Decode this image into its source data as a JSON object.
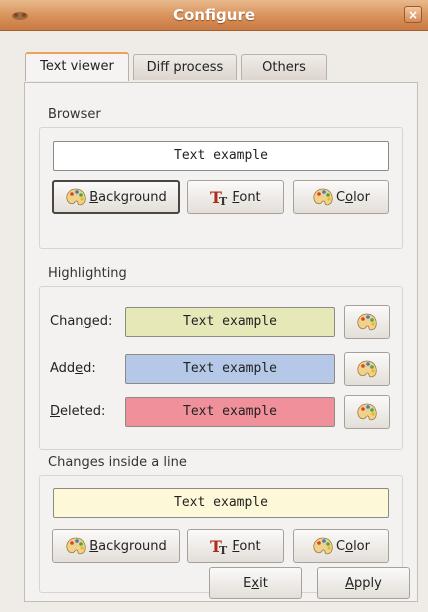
{
  "window": {
    "title": "Configure",
    "close_label": "×"
  },
  "tabs": [
    {
      "label": "Text viewer",
      "active": true
    },
    {
      "label": "Diff process",
      "active": false
    },
    {
      "label": "Others",
      "active": false
    }
  ],
  "browser": {
    "title": "Browser",
    "sample_text": "Text example",
    "background_button": {
      "pre": "",
      "mnemonic": "B",
      "post": "ackground"
    },
    "font_button": {
      "pre": "",
      "mnemonic": "F",
      "post": "ont"
    },
    "color_button": {
      "pre": "C",
      "mnemonic": "o",
      "post": "lor"
    }
  },
  "highlighting": {
    "title": "Highlighting",
    "rows": [
      {
        "label_pre": "Chan",
        "label_mnemonic": "g",
        "label_post": "ed:",
        "sample_text": "Text example",
        "color": "#e6e8b8"
      },
      {
        "label_pre": "Add",
        "label_mnemonic": "e",
        "label_post": "d:",
        "sample_text": "Text example",
        "color": "#b6c8e8"
      },
      {
        "label_pre": "",
        "label_mnemonic": "D",
        "label_post": "eleted:",
        "sample_text": "Text example",
        "color": "#f0909a"
      }
    ]
  },
  "changes_inside_line": {
    "title": "Changes inside a line",
    "sample_text": "Text example",
    "sample_color": "#fdf9d8",
    "background_button": {
      "pre": "",
      "mnemonic": "B",
      "post": "ackground"
    },
    "font_button": {
      "pre": "",
      "mnemonic": "F",
      "post": "ont"
    },
    "color_button": {
      "pre": "C",
      "mnemonic": "o",
      "post": "lor"
    }
  },
  "footer": {
    "exit": {
      "pre": "E",
      "mnemonic": "x",
      "post": "it"
    },
    "apply": {
      "pre": "",
      "mnemonic": "A",
      "post": "pply"
    }
  },
  "colors": {
    "titlebar": "#d8915a",
    "tab_accent": "#e8a25c"
  }
}
